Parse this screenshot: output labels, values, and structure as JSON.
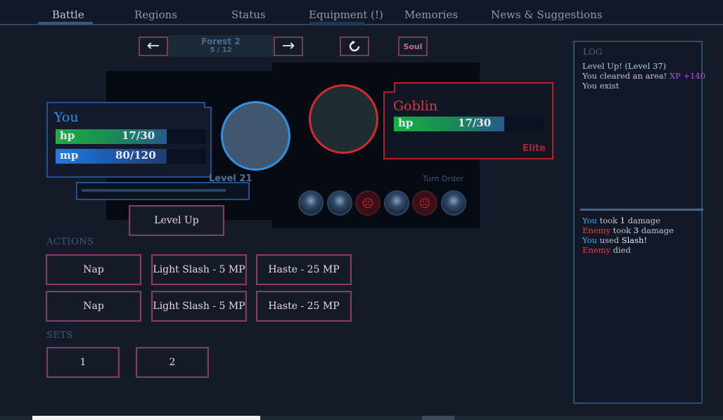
{
  "nav": {
    "tabs": [
      {
        "label": "Battle",
        "active": true
      },
      {
        "label": "Regions"
      },
      {
        "label": "Status"
      },
      {
        "label": "Equipment (!)"
      },
      {
        "label": "Memories"
      },
      {
        "label": "News & Suggestions"
      }
    ]
  },
  "area": {
    "name": "Forest 2",
    "progress": "5 / 12",
    "prev_icon": "arrow-left-icon",
    "next_icon": "arrow-right-icon",
    "refresh_icon": "refresh-icon",
    "soul_label": "Soul"
  },
  "player": {
    "name": "You",
    "hp_label": "hp",
    "hp_value": "17/30",
    "hp_fraction": 0.567,
    "mp_label": "mp",
    "mp_value": "80/120",
    "mp_fraction": 0.667,
    "level": "Level 21",
    "level_up_label": "Level Up"
  },
  "enemy": {
    "name": "Goblin",
    "hp_label": "hp",
    "hp_value": "17/30",
    "hp_fraction": 0.567,
    "rank": "Elite"
  },
  "turn_order": {
    "label": "Turn Order",
    "sequence": [
      "you",
      "you",
      "enemy",
      "you",
      "enemy",
      "you"
    ]
  },
  "actions": {
    "label": "ACTIONS",
    "row1": [
      "Nap",
      "Light Slash - 5 MP",
      "Haste - 25 MP"
    ],
    "row2": [
      "Nap",
      "Light Slash - 5 MP",
      "Haste - 25 MP"
    ]
  },
  "sets": {
    "label": "SETS",
    "items": [
      "1",
      "2"
    ]
  },
  "log": {
    "title": "LOG",
    "top_lines": {
      "level_up": "Level Up!",
      "level_up_detail": "(Level 37)",
      "cleared": "You cleared an area!",
      "xp": "XP +140",
      "exist": "You exist"
    },
    "combat_lines": {
      "l1_actor": "You",
      "l1_text": "took",
      "l1_num": "1",
      "l1_tail": "damage",
      "l2_actor": "Enemy",
      "l2_text": "took",
      "l2_num": "3",
      "l2_tail": "damage",
      "l3_actor": "You",
      "l3_text": "used",
      "l3_skill": "Slash!",
      "l4_actor": "Enemy",
      "l4_text": "died"
    }
  },
  "colors": {
    "player_accent": "#2c93e4",
    "enemy_accent": "#d02b30",
    "button_border": "#8a3a62",
    "hp_bar": "#1fa046",
    "mp_bar": "#1e6fd0"
  }
}
